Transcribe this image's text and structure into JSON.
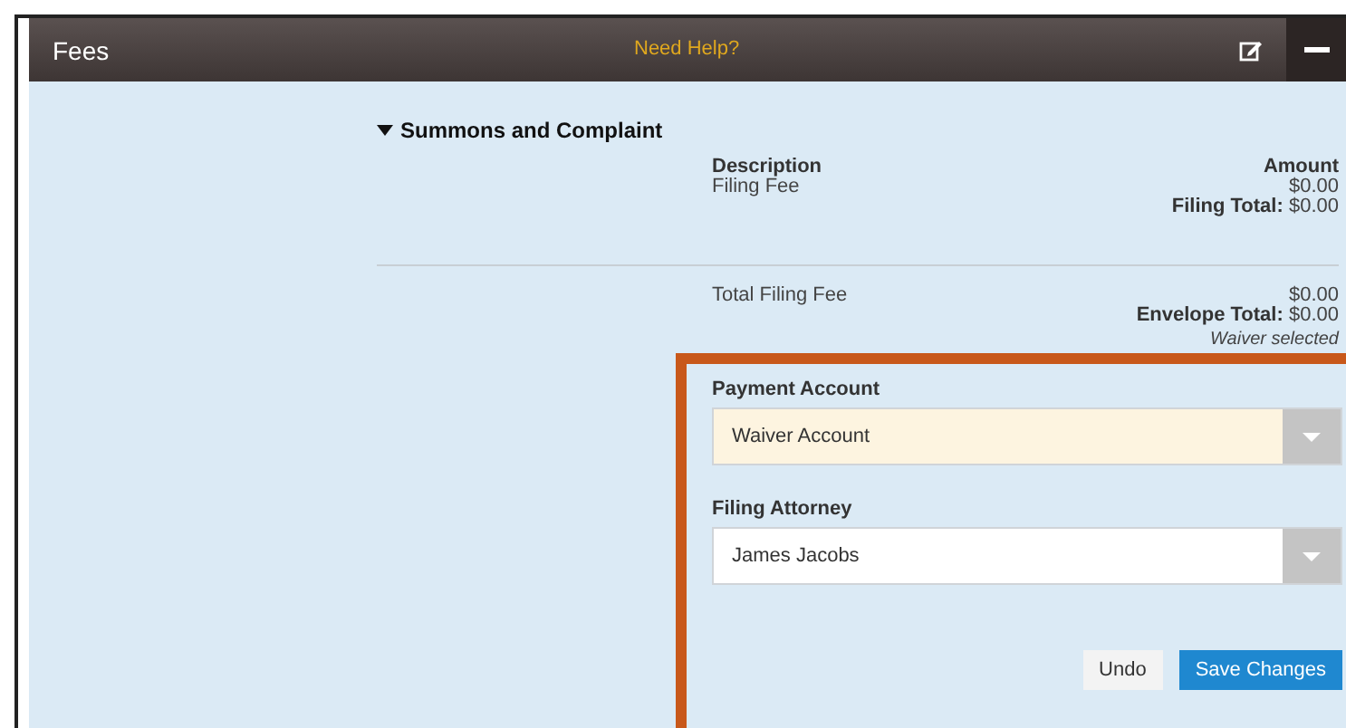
{
  "header": {
    "title": "Fees",
    "help_link": "Need Help?"
  },
  "section": {
    "title": "Summons and Complaint",
    "expanded": true,
    "columns": [
      "Description",
      "Amount"
    ],
    "fees": [
      {
        "description": "Filing Fee",
        "amount": "$0.00"
      }
    ],
    "filing_total": {
      "label": "Filing Total:",
      "value": "$0.00"
    },
    "totals": [
      {
        "description": "Total Filing Fee",
        "amount": "$0.00"
      }
    ],
    "envelope_total": {
      "label": "Envelope Total:",
      "value": "$0.00"
    },
    "note": "Waiver selected"
  },
  "form": {
    "fields": [
      {
        "label": "Payment Account",
        "value": "Waiver Account",
        "highlighted": true
      },
      {
        "label": "Filing Attorney",
        "value": "James Jacobs",
        "highlighted": false
      }
    ],
    "buttons": [
      {
        "label": "Undo",
        "kind": "secondary"
      },
      {
        "label": "Save Changes",
        "kind": "primary"
      }
    ]
  }
}
